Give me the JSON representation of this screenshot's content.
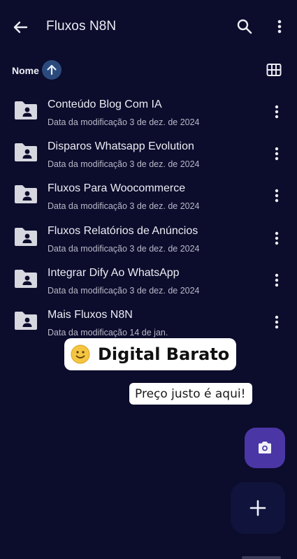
{
  "appbar": {
    "title": "Fluxos N8N",
    "back_icon": "arrow-left-icon",
    "search_icon": "search-icon",
    "more_icon": "more-vert-icon"
  },
  "sort": {
    "label": "Nome",
    "direction": "ascending",
    "direction_icon": "arrow-up-icon",
    "view_icon": "grid-view-icon"
  },
  "folders": [
    {
      "name": "Conteúdo Blog Com IA",
      "modified": "Data da modificação 3 de dez. de 2024"
    },
    {
      "name": "Disparos Whatsapp Evolution",
      "modified": "Data da modificação 3 de dez. de 2024"
    },
    {
      "name": "Fluxos Para Woocommerce",
      "modified": "Data da modificação 3 de dez. de 2024"
    },
    {
      "name": "Fluxos Relatórios de Anúncios",
      "modified": "Data da modificação 3 de dez. de 2024"
    },
    {
      "name": "Integrar Dify Ao WhatsApp",
      "modified": "Data da modificação 3 de dez. de 2024"
    },
    {
      "name": "Mais Fluxos N8N",
      "modified": "Data da modificação 14 de jan."
    }
  ],
  "overlay": {
    "banner": "Digital Barato",
    "tagline": "Preço justo é aqui!"
  },
  "fabs": {
    "camera_icon": "camera-icon",
    "add_icon": "plus-icon"
  },
  "colors": {
    "background": "#0c0c2c",
    "sort_badge": "#2b4a7c",
    "fab_camera": "#4b36a6",
    "fab_add": "#10143c"
  }
}
